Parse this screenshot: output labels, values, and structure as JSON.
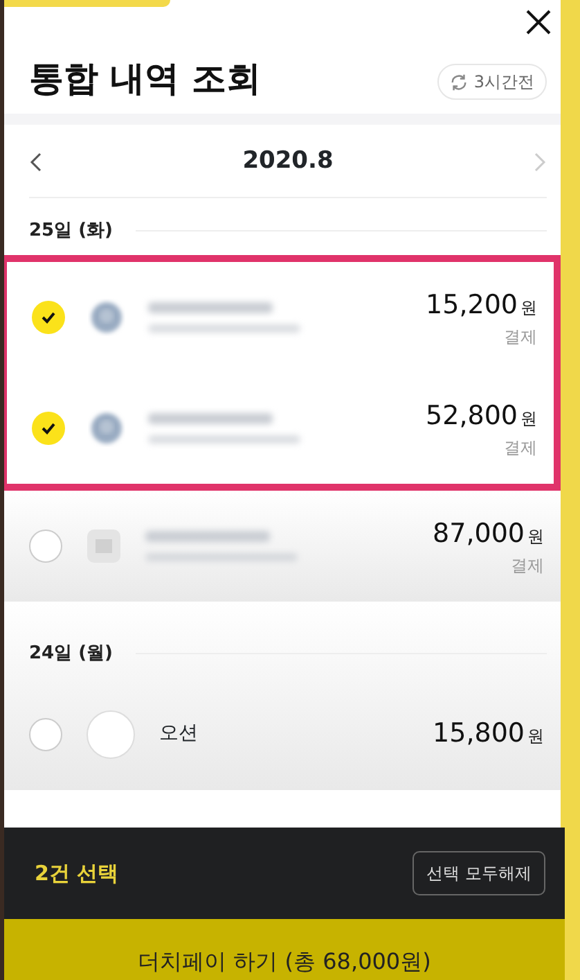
{
  "header": {
    "title": "통합 내역 조회",
    "refresh": "3시간전"
  },
  "month_nav": {
    "month": "2020.8"
  },
  "days": [
    {
      "day": "25일 (화)",
      "items": [
        {
          "selected": true,
          "highlighted": true,
          "kind": "circle",
          "amount": "15,200",
          "unit": "원",
          "type": "결제"
        },
        {
          "selected": true,
          "highlighted": true,
          "kind": "circle",
          "amount": "52,800",
          "unit": "원",
          "type": "결제"
        },
        {
          "selected": false,
          "highlighted": false,
          "kind": "square",
          "amount": "87,000",
          "unit": "원",
          "type": "결제"
        }
      ]
    },
    {
      "day": "24일 (월)",
      "items": [
        {
          "selected": false,
          "highlighted": false,
          "kind": "outline",
          "name": "오션",
          "amount": "15,800",
          "unit": "원"
        }
      ]
    }
  ],
  "selection_bar": {
    "count": "2건 선택",
    "clear_button": "선택 모두해제"
  },
  "action_button": "더치페이 하기 (총 68,000원)"
}
